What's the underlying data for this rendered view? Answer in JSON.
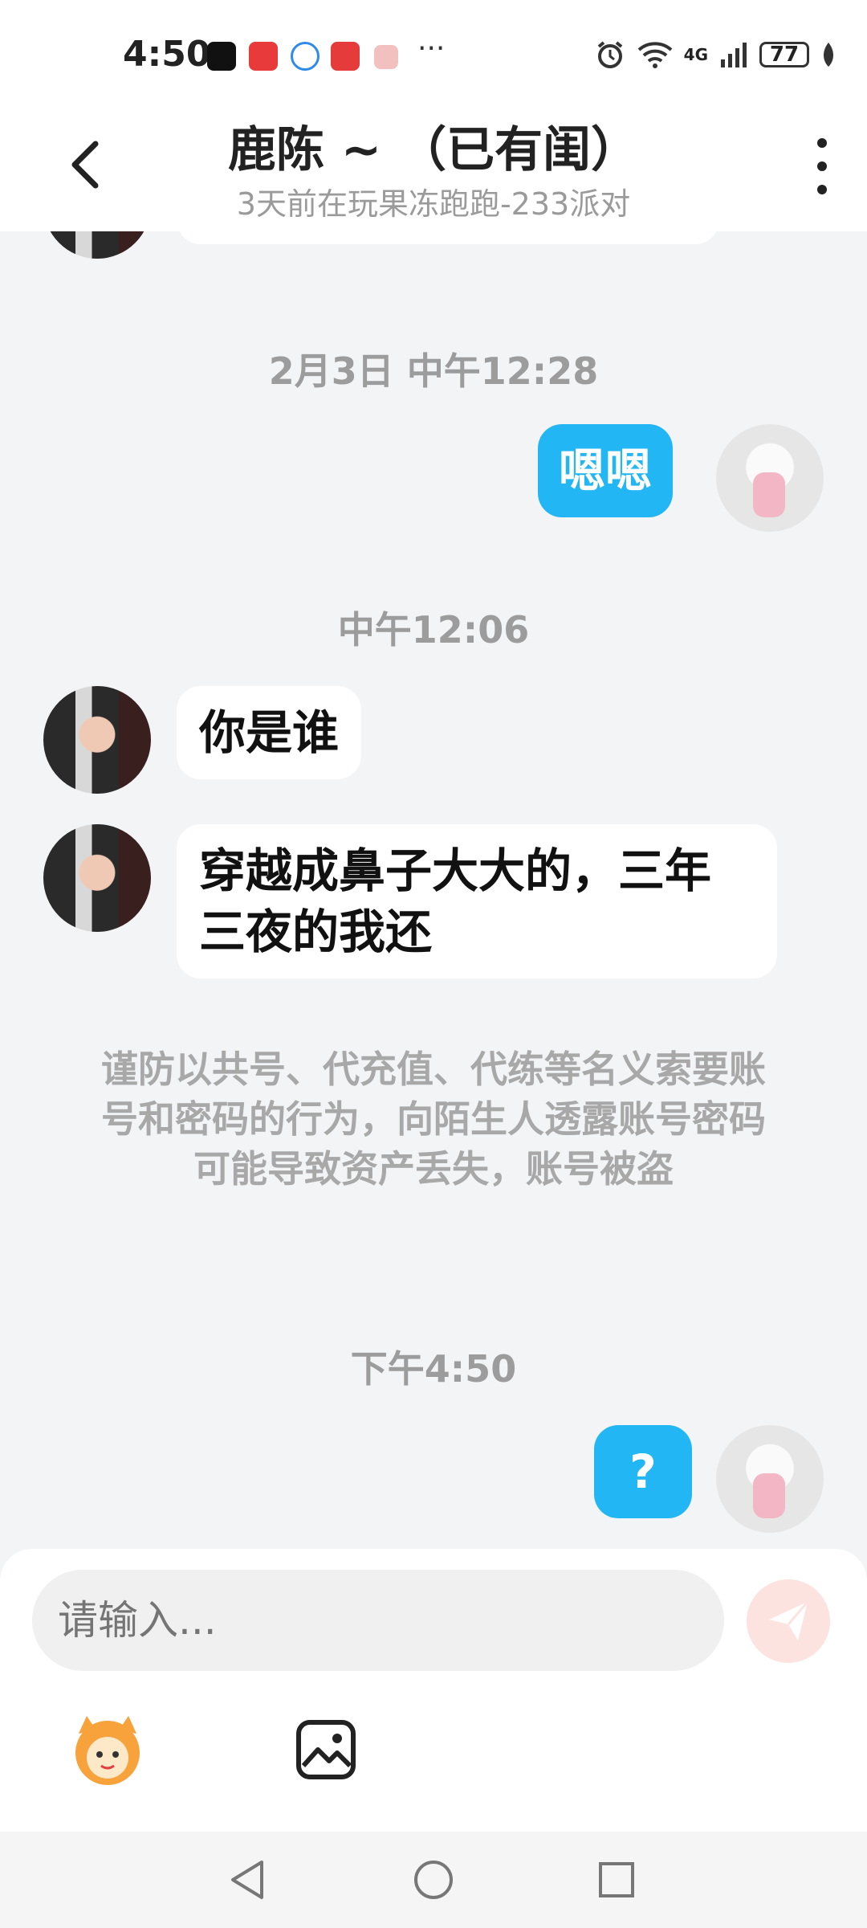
{
  "status_bar": {
    "time": "4:50",
    "network": "4G",
    "battery": "77",
    "more": "···"
  },
  "header": {
    "title": "鹿陈 ~ （已有闺）",
    "subtitle": "3天前在玩果冻跑跑-233派对"
  },
  "messages": {
    "timestamp1": "2月3日 中午12:28",
    "msg1": "嗯嗯",
    "timestamp2": "中午12:06",
    "msg2": "你是谁",
    "msg3": "穿越成鼻子大大的，三年三夜的我还",
    "notice": "谨防以共号、代充值、代练等名义索要账号和密码的行为，向陌生人透露账号密码可能导致资产丢失，账号被盗",
    "timestamp3": "下午4:50",
    "msg4": "?"
  },
  "input": {
    "placeholder": "请输入..."
  },
  "colors": {
    "bubble_out": "#22b6f5",
    "bubble_in": "#ffffff",
    "background": "#f3f4f6",
    "send_button": "#fde3e0"
  },
  "icons": [
    "back-icon",
    "more-vertical-icon",
    "send-icon",
    "emoji-mascot-icon",
    "image-icon",
    "nav-back-icon",
    "nav-home-icon",
    "nav-recents-icon"
  ]
}
